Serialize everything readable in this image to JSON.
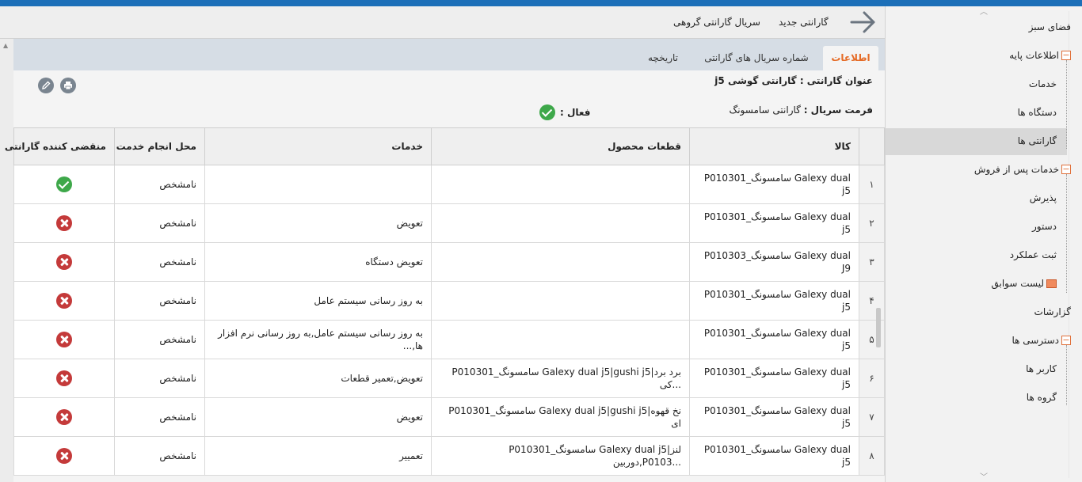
{
  "toolbar": {
    "new_warranty": "گارانتی جدید",
    "group_serial": "سریال گارانتی گروهی"
  },
  "tabs": [
    {
      "label": "اطلاعات",
      "active": true
    },
    {
      "label": "شماره سریال های گارانتی",
      "active": false
    },
    {
      "label": "تاریخچه",
      "active": false
    }
  ],
  "info": {
    "title_label": "عنوان گارانتی :",
    "title_value": "گارانتی گوشی j5",
    "format_label": "فرمت سریال :",
    "format_value": "گارانتی سامسونگ",
    "active_label": "فعال :"
  },
  "table": {
    "headers": [
      "کالا",
      "قطعات محصول",
      "خدمات",
      "محل انجام خدمت",
      "منقضی کننده گارانتی"
    ],
    "rows": [
      {
        "num": "۱",
        "item": "P010301_سامسونگ Galexy dual j5",
        "parts": "",
        "services": "",
        "place": "نامشخص",
        "expiring": true
      },
      {
        "num": "۲",
        "item": "P010301_سامسونگ Galexy dual j5",
        "parts": "",
        "services": "تعویض",
        "place": "نامشخص",
        "expiring": false
      },
      {
        "num": "۳",
        "item": "P010303_سامسونگ Galexy dual J9",
        "parts": "",
        "services": "تعویض دستگاه",
        "place": "نامشخص",
        "expiring": false
      },
      {
        "num": "۴",
        "item": "P010301_سامسونگ Galexy dual j5",
        "parts": "",
        "services": "به روز رسانی سیستم عامل",
        "place": "نامشخص",
        "expiring": false
      },
      {
        "num": "۵",
        "item": "P010301_سامسونگ Galexy dual j5",
        "parts": "",
        "services": "به روز رسانی سیستم عامل,به روز رسانی نرم افزار ها,...",
        "place": "نامشخص",
        "expiring": false
      },
      {
        "num": "۶",
        "item": "P010301_سامسونگ Galexy dual j5",
        "parts": "P010301_سامسونگ Galexy dual j5|gushi j5|برد برد کی...",
        "services": "تعویض,تعمیر قطعات",
        "place": "نامشخص",
        "expiring": false
      },
      {
        "num": "۷",
        "item": "P010301_سامسونگ Galexy dual j5",
        "parts": "P010301_سامسونگ Galexy dual j5|gushi j5|نخ قهوه ای",
        "services": "تعویض",
        "place": "نامشخص",
        "expiring": false
      },
      {
        "num": "۸",
        "item": "P010301_سامسونگ Galexy dual j5",
        "parts": "P010301_سامسونگ Galexy dual j5|لنز دوربین,P0103...",
        "services": "تعمییر",
        "place": "نامشخص",
        "expiring": false
      }
    ]
  },
  "sidebar": {
    "items": [
      {
        "label": "فضای سبز",
        "level": 0,
        "toggle": false
      },
      {
        "label": "اطلاعات پایه",
        "level": 0,
        "toggle": true
      },
      {
        "label": "خدمات",
        "level": 1,
        "toggle": false
      },
      {
        "label": "دستگاه ها",
        "level": 1,
        "toggle": false
      },
      {
        "label": "گارانتی ها",
        "level": 1,
        "toggle": false,
        "selected": true
      },
      {
        "label": "خدمات پس از فروش",
        "level": 0,
        "toggle": true
      },
      {
        "label": "پذیرش",
        "level": 1,
        "toggle": false
      },
      {
        "label": "دستور",
        "level": 1,
        "toggle": false
      },
      {
        "label": "ثبت عملکرد",
        "level": 1,
        "toggle": false
      },
      {
        "label": "لیست سوابق",
        "level": 1,
        "toggle": false,
        "history_icon": true
      },
      {
        "label": "گزارشات",
        "level": 0,
        "toggle": false
      },
      {
        "label": "دسترسی ها",
        "level": 0,
        "toggle": true
      },
      {
        "label": "کاربر ها",
        "level": 1,
        "toggle": false
      },
      {
        "label": "گروه ها",
        "level": 1,
        "toggle": false
      }
    ]
  },
  "colors": {
    "accent": "#e56b26",
    "topbar": "#1c6fb8",
    "ok": "#3ea84a",
    "error": "#c43a3a"
  }
}
